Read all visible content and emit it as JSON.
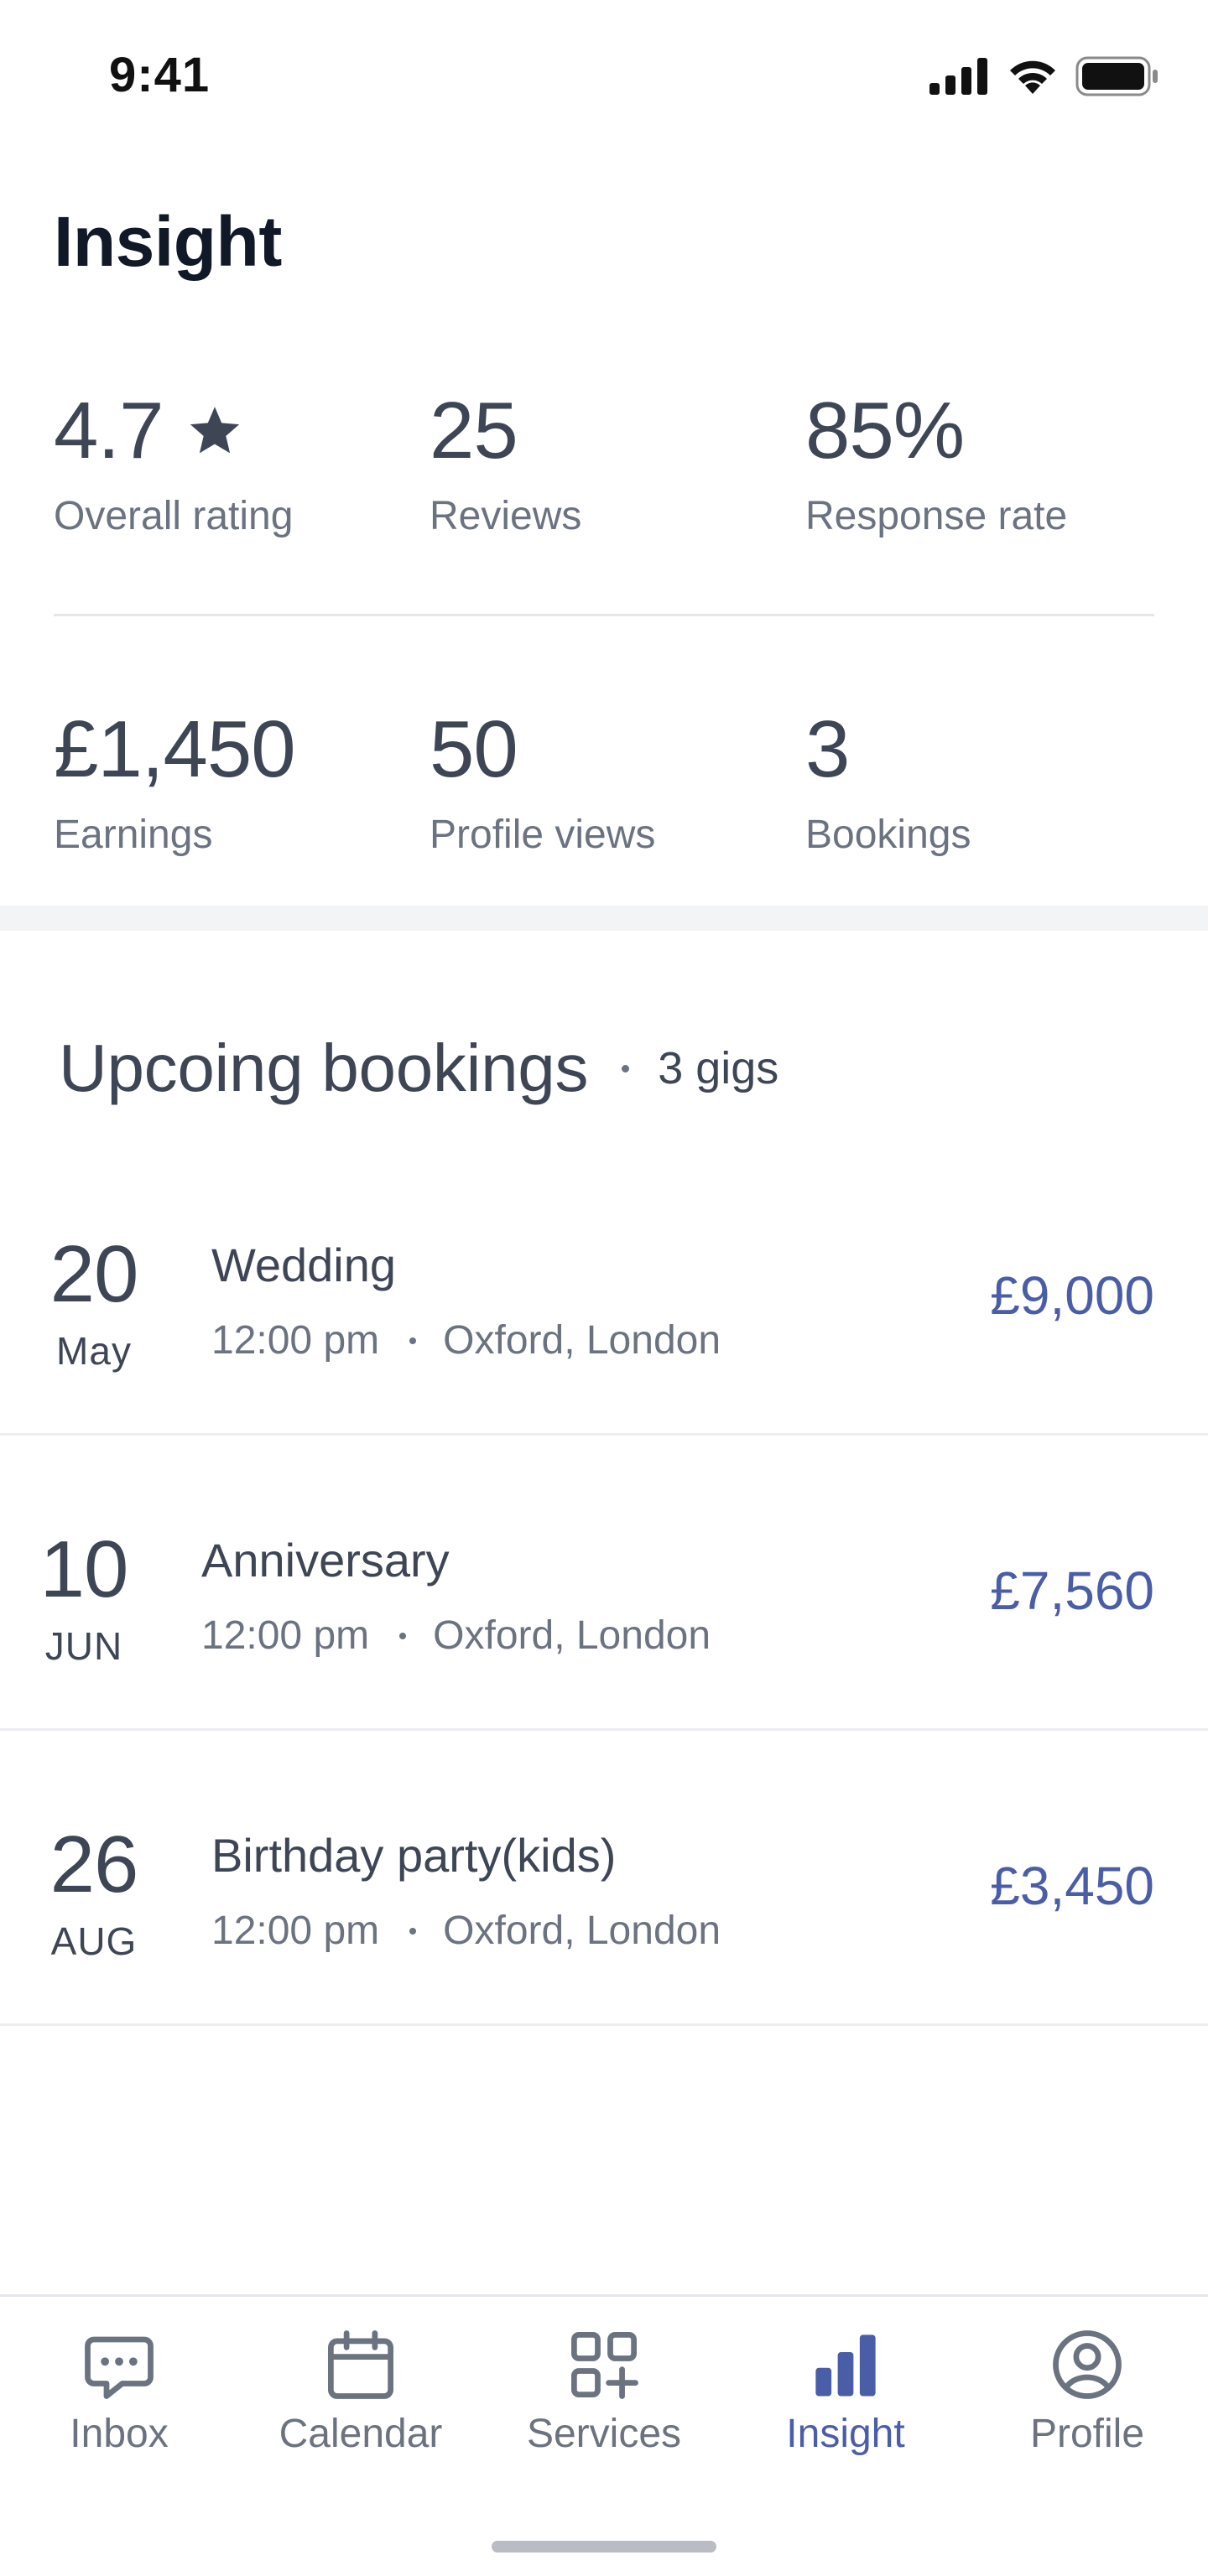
{
  "status_bar": {
    "time": "9:41"
  },
  "header": {
    "title": "Insight"
  },
  "stats": {
    "rating": {
      "value": "4.7",
      "label": "Overall rating",
      "icon": "star-icon"
    },
    "reviews": {
      "value": "25",
      "label": "Reviews"
    },
    "response": {
      "value": "85%",
      "label": "Response rate"
    },
    "earnings": {
      "value": "£1,450",
      "label": "Earnings"
    },
    "views": {
      "value": "50",
      "label": "Profile views"
    },
    "bookings": {
      "value": "3",
      "label": "Bookings"
    }
  },
  "upcoming": {
    "title": "Upcoing bookings",
    "count": "3 gigs",
    "items": [
      {
        "day": "20",
        "month": "May",
        "title": "Wedding",
        "time": "12:00 pm",
        "location": "Oxford, London",
        "price": "£9,000"
      },
      {
        "day": "10",
        "month": "JUN",
        "title": "Anniversary",
        "time": "12:00 pm",
        "location": "Oxford, London",
        "price": "£7,560"
      },
      {
        "day": "26",
        "month": "AUG",
        "title": "Birthday party(kids)",
        "time": "12:00 pm",
        "location": "Oxford, London",
        "price": "£3,450"
      }
    ]
  },
  "tabs": [
    {
      "label": "Inbox",
      "icon": "chat-icon",
      "active": false
    },
    {
      "label": "Calendar",
      "icon": "calendar-icon",
      "active": false
    },
    {
      "label": "Services",
      "icon": "grid-plus-icon",
      "active": false
    },
    {
      "label": "Insight",
      "icon": "bar-chart-icon",
      "active": true
    },
    {
      "label": "Profile",
      "icon": "user-circle-icon",
      "active": false
    }
  ],
  "colors": {
    "accent": "#4a5ea8",
    "text": "#3e4656",
    "muted": "#6b7280",
    "inactive_icon": "#6b7280"
  }
}
